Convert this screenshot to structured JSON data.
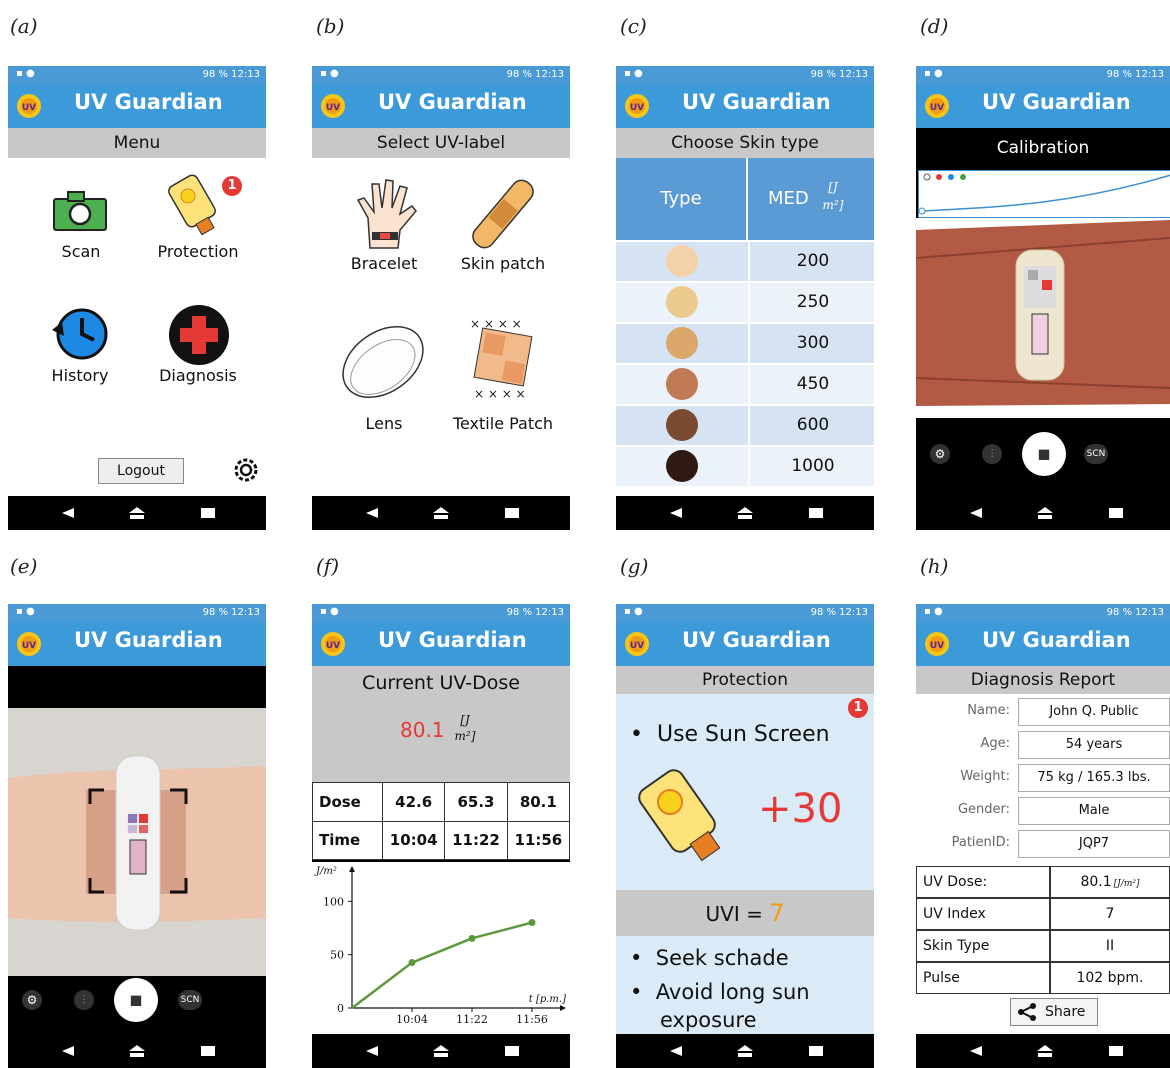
{
  "panel_labels": [
    "(a)",
    "(b)",
    "(c)",
    "(d)",
    "(e)",
    "(f)",
    "(g)",
    "(h)"
  ],
  "status_bar": {
    "right": "98 % 12:13"
  },
  "app_title": "UV Guardian",
  "logo_text": "UV",
  "a": {
    "subtitle": "Menu",
    "items": {
      "scan": "Scan",
      "protection": "Protection",
      "history": "History",
      "diagnosis": "Diagnosis"
    },
    "badge": "1",
    "logout": "Logout"
  },
  "b": {
    "subtitle": "Select UV-label",
    "items": {
      "bracelet": "Bracelet",
      "skin_patch": "Skin patch",
      "lens": "Lens",
      "textile_patch": "Textile Patch"
    }
  },
  "c": {
    "subtitle": "Choose Skin type",
    "col_type": "Type",
    "col_med": "MED",
    "unit_num": "J",
    "unit_den": "m²",
    "rows": [
      {
        "color": "#f4d2a8",
        "med": "200"
      },
      {
        "color": "#ecc98f",
        "med": "250"
      },
      {
        "color": "#d9a86a",
        "med": "300"
      },
      {
        "color": "#c07b54",
        "med": "450"
      },
      {
        "color": "#7a4a31",
        "med": "600"
      },
      {
        "color": "#2e1a12",
        "med": "1000"
      }
    ]
  },
  "d": {
    "subtitle": "Calibration",
    "scn": "SCN"
  },
  "e": {
    "scn": "SCN"
  },
  "f": {
    "subtitle": "Current UV-Dose",
    "dose_value": "80.1",
    "unit_num": "J",
    "unit_den": "m²",
    "table": {
      "row1_label": "Dose",
      "row1": [
        "42.6",
        "65.3",
        "80.1"
      ],
      "row2_label": "Time",
      "row2": [
        "10:04",
        "11:22",
        "11:56"
      ]
    }
  },
  "chart_data": {
    "type": "line",
    "x": [
      "0",
      "10:04",
      "11:22",
      "11:56"
    ],
    "values": [
      0,
      42.6,
      65.3,
      80.1
    ],
    "ylabel": "J/m²",
    "xlabel": "t [p.m.]",
    "yticks": [
      "0",
      "50",
      "100"
    ],
    "xticks": [
      "10:04",
      "11:22",
      "11:56"
    ],
    "ylim": [
      0,
      120
    ],
    "color": "#5a9a3a"
  },
  "g": {
    "subtitle": "Protection",
    "badge": "1",
    "bullet1": "Use Sun Screen",
    "spf": "+30",
    "uvi_label": "UVI =",
    "uvi_value": "7",
    "bullet2": "Seek schade",
    "bullet3": "Avoid long sun exposure"
  },
  "h": {
    "subtitle": "Diagnosis Report",
    "fields": [
      {
        "label": "Name:",
        "value": "John Q. Public"
      },
      {
        "label": "Age:",
        "value": "54 years"
      },
      {
        "label": "Weight:",
        "value": "75 kg / 165.3 lbs."
      },
      {
        "label": "Gender:",
        "value": "Male"
      },
      {
        "label": "PatienID:",
        "value": "JQP7"
      }
    ],
    "report": [
      {
        "label": "UV Dose:",
        "value": "80.1"
      },
      {
        "label": "UV Index",
        "value": "7"
      },
      {
        "label": "Skin Type",
        "value": "II"
      },
      {
        "label": "Pulse",
        "value": "102 bpm."
      }
    ],
    "share": "Share"
  }
}
